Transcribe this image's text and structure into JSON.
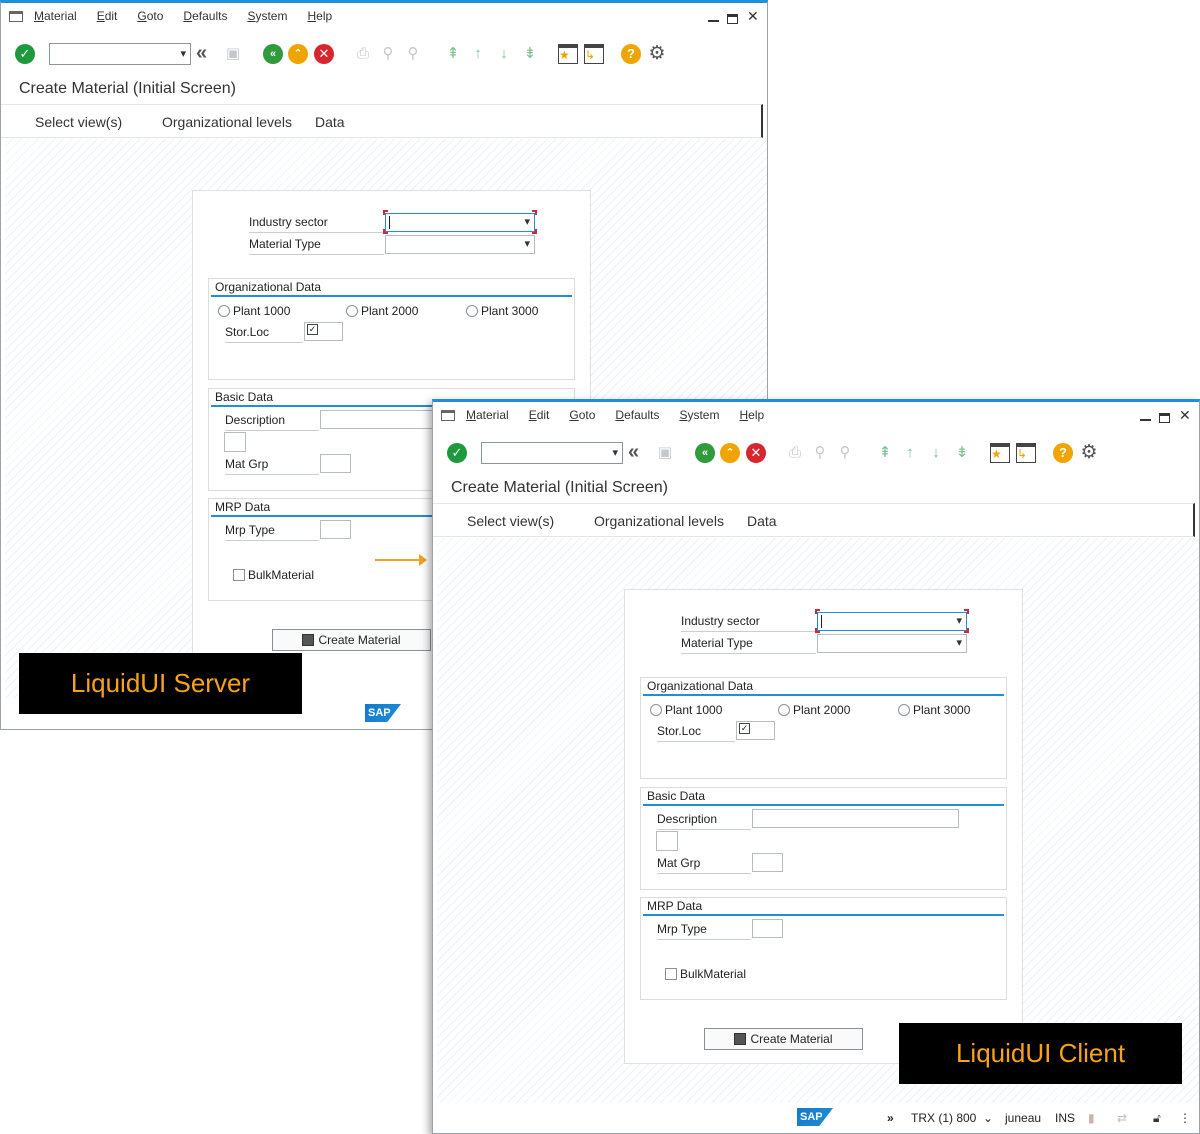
{
  "menu": [
    "Material",
    "Edit",
    "Goto",
    "Defaults",
    "System",
    "Help"
  ],
  "screen": {
    "title": "Create Material (Initial Screen)",
    "tabs": [
      "Select view(s)",
      "Organizational levels",
      "Data"
    ]
  },
  "form": {
    "industry_sector_label": "Industry sector",
    "material_type_label": "Material Type",
    "org_data_title": "Organizational Data",
    "plants": [
      "Plant 1000",
      "Plant 2000",
      "Plant 3000"
    ],
    "storloc_label": "Stor.Loc",
    "basic_data_title": "Basic Data",
    "description_label": "Description",
    "matgrp_label": "Mat Grp",
    "mrp_data_title": "MRP Data",
    "mrp_type_label": "Mrp Type",
    "bulk_label": "BulkMaterial",
    "create_button": "Create Material"
  },
  "status": {
    "transaction": "TRX (1) 800",
    "user": "juneau",
    "mode": "INS"
  },
  "labels": {
    "server": "LiquidUI Server",
    "client": "LiquidUI Client"
  },
  "colors": {
    "accent": "#1f8fd8",
    "ok_green": "#1e9a3c",
    "nav_green": "#2f9b3b",
    "exit_yellow": "#f0a400",
    "cancel_red": "#d8262e",
    "help_yellow": "#f0a400",
    "tag_text": "#f7a21b"
  }
}
